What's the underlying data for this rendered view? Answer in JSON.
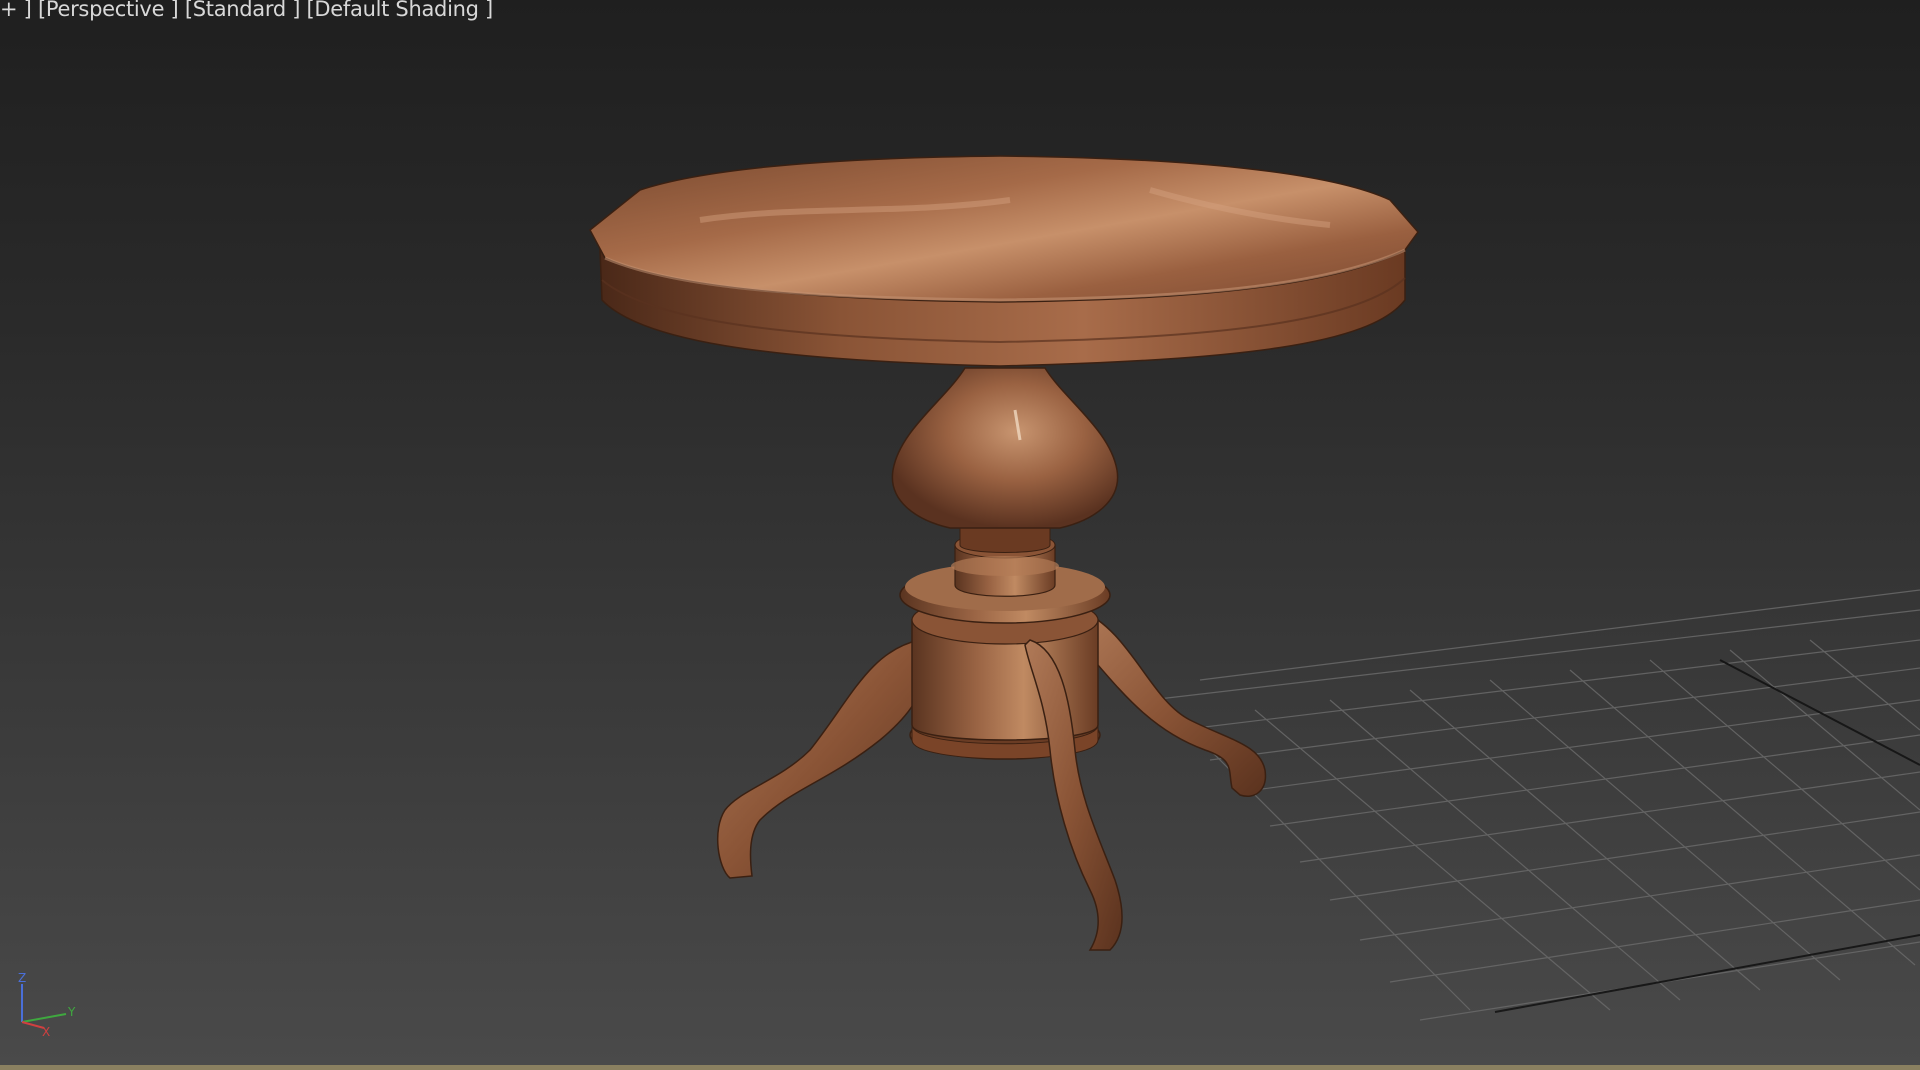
{
  "viewport": {
    "plus_menu": "+ ]",
    "view_label": "[Perspective ]",
    "camera_label": "[Standard ]",
    "shading_label": "[Default Shading ]"
  },
  "scene": {
    "object": "round pedestal table",
    "material_color": "#8a5435",
    "background_top": "#1f1f1f",
    "background_bottom": "#4a4a4a",
    "grid_color": "#6a6a6a"
  },
  "gizmo": {
    "z_label": "Z",
    "x_label": "X",
    "y_label": "Y",
    "z_color": "#4a6fd8",
    "x_color": "#d04040",
    "y_color": "#3fa83f"
  }
}
